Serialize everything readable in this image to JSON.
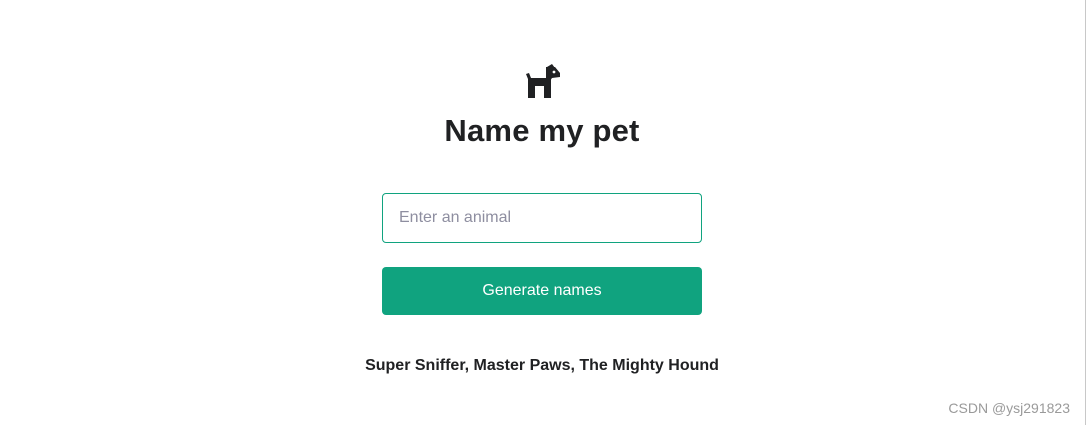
{
  "header": {
    "logo_icon": "dog-icon",
    "title": "Name my pet"
  },
  "form": {
    "animal_input": {
      "value": "",
      "placeholder": "Enter an animal"
    },
    "submit_label": "Generate names"
  },
  "result": {
    "text": "Super Sniffer, Master Paws, The Mighty Hound"
  },
  "watermark": "CSDN @ysj291823",
  "colors": {
    "accent": "#10a37f",
    "text": "#202123",
    "placeholder": "#8e8ea0"
  }
}
